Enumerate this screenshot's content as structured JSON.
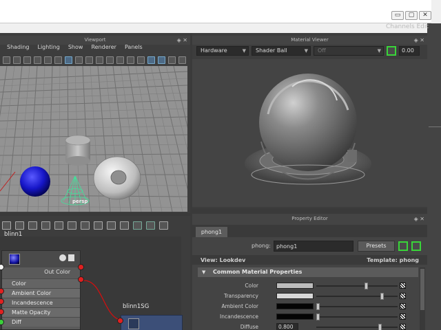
{
  "window": {
    "controls": [
      "▭",
      "▢",
      "✕"
    ],
    "right_menu": "Channels  Edit"
  },
  "viewport": {
    "title": "Viewport",
    "menu": [
      "Shading",
      "Lighting",
      "Show",
      "Renderer",
      "Panels"
    ],
    "camera": "persp"
  },
  "material_viewer": {
    "title": "Material Viewer",
    "renderer": "Hardware",
    "shape": "Shader Ball",
    "env": "Off",
    "exposure": "0.00"
  },
  "property_editor": {
    "title": "Property Editor",
    "tab": "phong1",
    "name_label": "phong:",
    "name_value": "phong1",
    "presets": "Presets",
    "view_label": "View: Lookdev",
    "template_label": "Template: phong",
    "section": "Common Material Properties",
    "rows": [
      {
        "label": "Color",
        "type": "swatch",
        "swatch": "#bcbcbc",
        "slider": 0.62
      },
      {
        "label": "Transparency",
        "type": "swatch",
        "swatch": "#d8d8d8",
        "slider": 0.82
      },
      {
        "label": "Ambient Color",
        "type": "swatch",
        "swatch": "#050505",
        "slider": 0.0
      },
      {
        "label": "Incandescence",
        "type": "swatch",
        "swatch": "#050505",
        "slider": 0.0
      },
      {
        "label": "Diffuse",
        "type": "value",
        "value": "0.800",
        "slider": 0.8
      }
    ]
  },
  "node_editor": {
    "node_name": "blinn1",
    "out_color": "Out Color",
    "attributes": [
      "Color",
      "Ambient Color",
      "Incandescence",
      "Matte Opacity",
      "Diff"
    ],
    "sg_name": "blinn1SG"
  }
}
